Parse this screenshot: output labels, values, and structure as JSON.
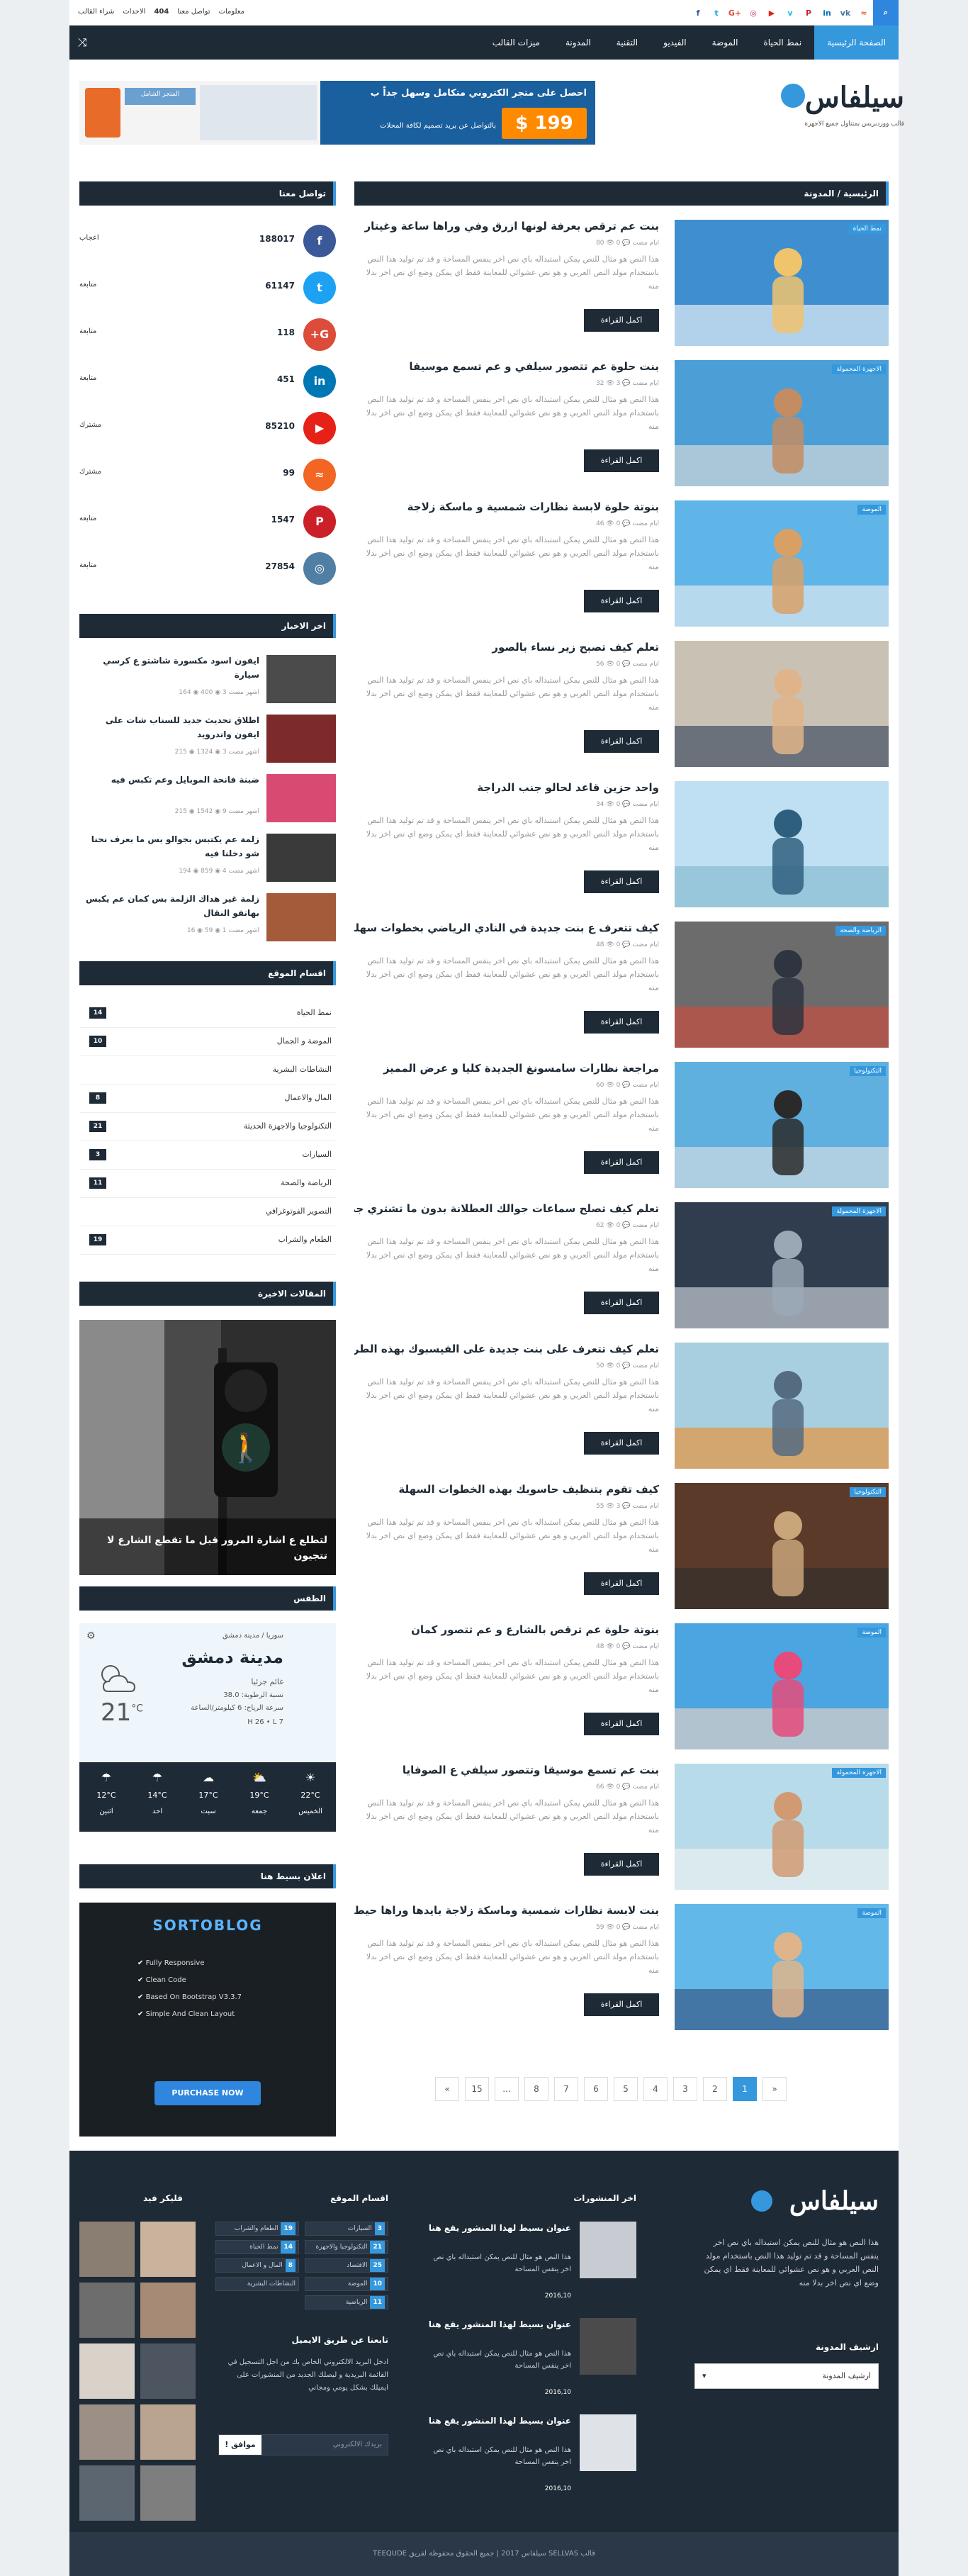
{
  "topbar": {
    "links": [
      "معلومات",
      "تواصل معنا",
      "404",
      "الاحداث",
      "شراء القالب"
    ],
    "social_icons": [
      "facebook-icon",
      "twitter-icon",
      "googleplus-icon",
      "instagram-icon",
      "youtube-icon",
      "vimeo-icon",
      "pinterest-icon",
      "linkedin-icon",
      "vk-icon",
      "rss-icon"
    ],
    "social_glyphs": [
      "f",
      "t",
      "G+",
      "◎",
      "▶",
      "v",
      "P",
      "in",
      "vk",
      "≈"
    ],
    "social_colors": [
      "#3b5998",
      "#1da1f2",
      "#dd4b39",
      "#c13584",
      "#e62117",
      "#1ab7ea",
      "#cb2027",
      "#0077b5",
      "#4c75a3",
      "#f26522"
    ]
  },
  "nav": {
    "items": [
      "الصفحة الرئيسية",
      "نمط الحياة",
      "الموضة",
      "الفيديو",
      "التقنية",
      "المدونة",
      "ميزات القالب"
    ]
  },
  "logo": {
    "name": "سيلفاس",
    "tagline": "قالب ووردبريس بمتناول جميع الاجهزة"
  },
  "ad": {
    "line1": "احصل على متجر الكتروني متكامل وسهل جداً ب",
    "price": "199 $",
    "line2": "بالتواصل عن بريد تصميم لكافة المحلات",
    "store_label": "المتجر الشامل"
  },
  "main": {
    "heading": "الرئيسية / المدونة",
    "read_more": "اكمل القراءة",
    "posts": [
      {
        "title": "بنت عم ترقص بعرفة لونها ازرق وفي وراها ساعة وغيتار",
        "date": "ايام مضت",
        "comments": "0",
        "views": "80",
        "badge": "نمط الحياة",
        "img": "blue"
      },
      {
        "title": "بنت حلوة عم تتصور سيلفي و عم تسمع موسيقا",
        "date": "ايام مضت",
        "comments": "3",
        "views": "32",
        "badge": "الاجهزة المحمولة",
        "img": "selfie"
      },
      {
        "title": "بنوتة حلوة لابسة نظارات شمسية و ماسكة زلاجة",
        "date": "ايام مضت",
        "comments": "0",
        "views": "46",
        "badge": "الموضة",
        "img": "skate"
      },
      {
        "title": "تعلم كيف تصبح زير نساء بالصور",
        "date": "ايام مضت",
        "comments": "0",
        "views": "56",
        "badge": "",
        "img": "couple"
      },
      {
        "title": "واحد حزين قاعد لحالو جنب الدراجة",
        "date": "ايام مضت",
        "comments": "0",
        "views": "34",
        "badge": "",
        "img": "bike"
      },
      {
        "title": "كيف تتعرف ع بنت جديدة في النادي الرياضي بخطوات سهلة",
        "date": "ايام مضت",
        "comments": "0",
        "views": "48",
        "badge": "الرياضة والصحة",
        "img": "gym"
      },
      {
        "title": "مراجعة نظارات سامسونغ الجديدة كليا و عرض المميز",
        "date": "ايام مضت",
        "comments": "0",
        "views": "60",
        "badge": "التكنولوجيا",
        "img": "vr"
      },
      {
        "title": "تعلم كيف تصلح سماعات جوالك العطلانة بدون ما تشتري جداد",
        "date": "ايام مضت",
        "comments": "0",
        "views": "62",
        "badge": "الاجهزة المحمولة",
        "img": "phone"
      },
      {
        "title": "تعلم كيف تتعرف على بنت جديدة على الفيسبوك بهذه الطريقة",
        "date": "ايام مضت",
        "comments": "0",
        "views": "50",
        "badge": "",
        "img": "orange"
      },
      {
        "title": "كيف تقوم بتنظيف حاسوبك بهذه الخطوات السهلة",
        "date": "ايام مضت",
        "comments": "3",
        "views": "55",
        "badge": "التكنولوجيا",
        "img": "turntable"
      },
      {
        "title": "بنوتة حلوة عم ترقص بالشارع و عم تتصور كمان",
        "date": "ايام مضت",
        "comments": "0",
        "views": "48",
        "badge": "الموضة",
        "img": "dance"
      },
      {
        "title": "بنت عم تسمع موسيقا وتتصور سيلفي ع الصوفايا",
        "date": "ايام مضت",
        "comments": "0",
        "views": "66",
        "badge": "الاجهزة المحمولة",
        "img": "sofa"
      },
      {
        "title": "بنت لابسة نظارات شمسية وماسكة زلاجة بايدها وراها حيط ازرق",
        "date": "ايام مضت",
        "comments": "0",
        "views": "59",
        "badge": "الموضة",
        "img": "denim"
      }
    ],
    "excerpt": "هذا النص هو مثال للنص يمكن استبداله باي نص اخر ينفس المساحة و قد تم توليد هذا النص باستخدام مولد النص العربي و هو نص عشوائي للمعاينة فقط اي يمكن وضع اي نص اخر بدلا منه"
  },
  "pagination": [
    "«",
    "15",
    "...",
    "8",
    "7",
    "6",
    "5",
    "4",
    "3",
    "2",
    "1",
    "»"
  ],
  "sidebar": {
    "contact": {
      "heading": "تواصل معنا",
      "rows": [
        {
          "icon": "facebook-icon",
          "glyph": "f",
          "color": "#3b5998",
          "count": "188017",
          "label": "اعجاب"
        },
        {
          "icon": "twitter-icon",
          "glyph": "t",
          "color": "#1da1f2",
          "count": "61147",
          "label": "متابعة"
        },
        {
          "icon": "googleplus-icon",
          "glyph": "G+",
          "color": "#dd4b39",
          "count": "118",
          "label": "متابعة"
        },
        {
          "icon": "linkedin-icon",
          "glyph": "in",
          "color": "#0077b5",
          "count": "451",
          "label": "متابعة"
        },
        {
          "icon": "youtube-icon",
          "glyph": "▶",
          "color": "#e62117",
          "count": "85210",
          "label": "مشترك"
        },
        {
          "icon": "rss-icon",
          "glyph": "≈",
          "color": "#f26522",
          "count": "99",
          "label": "مشترك"
        },
        {
          "icon": "pinterest-icon",
          "glyph": "P",
          "color": "#cb2027",
          "count": "1547",
          "label": "متابعة"
        },
        {
          "icon": "instagram-icon",
          "glyph": "◎",
          "color": "#517fa4",
          "count": "27854",
          "label": "متابعة"
        }
      ]
    },
    "news": {
      "heading": "اخر الاخبار",
      "items": [
        {
          "title": "ايفون اسود مكسورة شاشتو ع كرسي سيارة",
          "meta": "اشهر مضت  3  ◉ 400  ◉ 164"
        },
        {
          "title": "اطلاق تحديث جديد للسناب شات على ايفون واندرويد",
          "meta": "اشهر مضت  3  ◉ 1324  ◉ 215"
        },
        {
          "title": "ضبنة فانحة الموبايل وعم تكبس فيه",
          "meta": "اشهر مضت  9  ◉ 1542  ◉ 215"
        },
        {
          "title": "زلمة عم يكتبس بجوالو بس ما بعرف نحنا شو دخلنا فيه",
          "meta": "اشهر مضت  4  ◉ 859  ◉ 194"
        },
        {
          "title": "زلمة غير هداك الزلمة بس كمان عم يكبس بهاتفو النقال",
          "meta": "اشهر مضت  1  ◉ 59  ◉ 16"
        }
      ]
    },
    "categories": {
      "heading": "اقسام الموقع",
      "items": [
        {
          "name": "نمط الحياة",
          "count": "14"
        },
        {
          "name": "الموضة و الجمال",
          "count": "10"
        },
        {
          "name": "النشاطات البشرية",
          "count": ""
        },
        {
          "name": "المال والاعمال",
          "count": "8"
        },
        {
          "name": "التكنولوجيا والاجهزة الحديثة",
          "count": "21"
        },
        {
          "name": "السيارات",
          "count": "3"
        },
        {
          "name": "الرياضة والصحة",
          "count": "11"
        },
        {
          "name": "التصوير الفوتوغرافي",
          "count": ""
        },
        {
          "name": "الطعام والشراب",
          "count": "19"
        }
      ]
    },
    "recent": {
      "heading": "المقالات الاخيرة",
      "caption": "لتطلع ع اشارة المرور قبل ما تقطع الشارع لا تتجيون"
    },
    "weather": {
      "heading": "الطقس",
      "region": "سوريا / مدينة دمشق",
      "city": "مدينة دمشق",
      "condition": "غائم جزئيا",
      "humidity": "نسبة الرطوبة: 38.0",
      "wind": "سرعة الرياح: 6 كيلومتر/الساعة",
      "hl": "H 26 • L 7",
      "temp": "21",
      "unit": "°C",
      "days": [
        {
          "name": "الخميس",
          "temp": "22°C"
        },
        {
          "name": "جمعة",
          "temp": "19°C"
        },
        {
          "name": "سبت",
          "temp": "17°C"
        },
        {
          "name": "احد",
          "temp": "14°C"
        },
        {
          "name": "اثنين",
          "temp": "12°C"
        }
      ]
    },
    "adbox": {
      "heading": "اعلان بسيط هنا",
      "brand": "SORTOBLOG",
      "features": [
        "Fully Responsive",
        "Clean Code",
        "Based On Bootstrap V3.3.7",
        "Simple And Clean Layout"
      ],
      "button": "PURCHASE NOW"
    }
  },
  "footer": {
    "about": "هذا النص هو مثال للنص يمكن استبداله باي نص اخر ينفس المساحة و قد تم توليد هذا النص باستخدام مولد النص العربي و هو نص عشوائي للمعاينة فقط اي يمكن وضع اي نص اخر بدلا منه",
    "archive_heading": "ارشيف المدونة",
    "archive_select": "ارشيف المدونة",
    "posts_heading": "اخر المنشورات",
    "posts": [
      {
        "title": "عنوان بسيط لهذا المنشور يقع هنا",
        "date": "2016,10"
      },
      {
        "title": "عنوان بسيط لهذا المنشور يقع هنا",
        "date": "2016,10"
      },
      {
        "title": "عنوان بسيط لهذا المنشور يقع هنا",
        "date": "2016,10"
      }
    ],
    "post_excerpt": "هذا النص هو مثال للنص يمكن استبداله باي نص اخر ينفس المساحة",
    "cats_heading": "اقسام الموقع",
    "cats": [
      {
        "name": "السيارات",
        "count": "3"
      },
      {
        "name": "الطعام والشراب",
        "count": "19"
      },
      {
        "name": "التكنولوجيا والاجهزة",
        "count": "21"
      },
      {
        "name": "نمط الحياة",
        "count": "14"
      },
      {
        "name": "الاقتصاد",
        "count": "25"
      },
      {
        "name": "المال و الاعمال",
        "count": "8"
      },
      {
        "name": "الموضة",
        "count": "10"
      },
      {
        "name": "النشاطات البشرية",
        "count": ""
      },
      {
        "name": "الرياضية",
        "count": "11"
      }
    ],
    "flickr_heading": "فليكر فيد",
    "subscribe_heading": "تابعنا عن طريق الايميل",
    "subscribe_text": "ادخل البريد الالكتروني الخاص بك من اجل التسجيل في القائمة البريدية و ليصلك الجديد من المنشورات على ايميلك بشكل يومي ومجاني",
    "subscribe_placeholder": "بريدك الالكتروني",
    "subscribe_button": "موافق !",
    "copyright": "قالب SELLVAS سيلفاس 2017 | جميع الحقوق محفوظة لفريق TEEQUDE"
  }
}
